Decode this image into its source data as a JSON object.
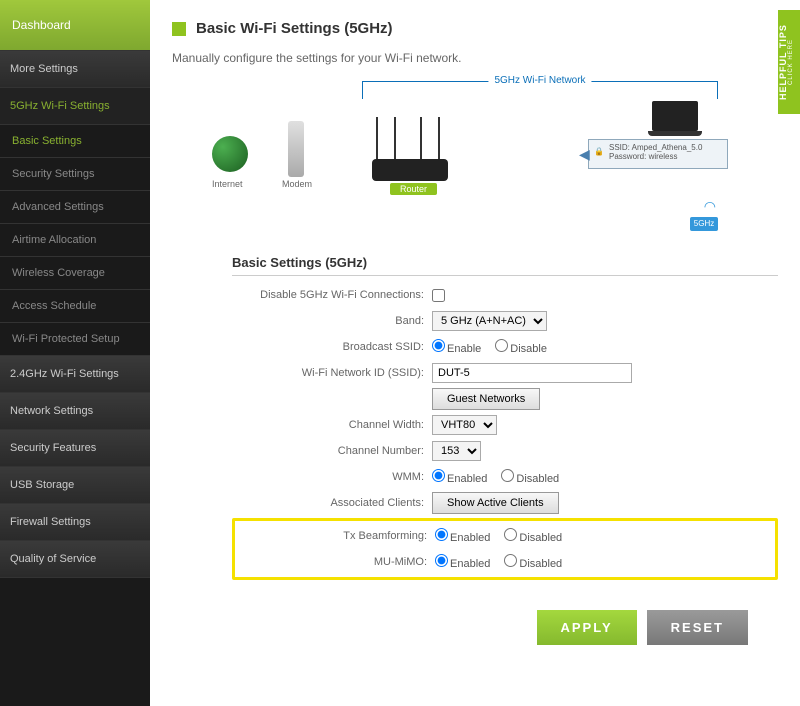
{
  "sidebar": {
    "dashboard": "Dashboard",
    "more": "More Settings",
    "section5g": "5GHz Wi-Fi Settings",
    "subs": [
      "Basic Settings",
      "Security Settings",
      "Advanced Settings",
      "Airtime Allocation",
      "Wireless Coverage",
      "Access Schedule",
      "Wi-Fi Protected Setup"
    ],
    "rest": [
      "2.4GHz Wi-Fi Settings",
      "Network Settings",
      "Security Features",
      "USB Storage",
      "Firewall Settings",
      "Quality of Service"
    ]
  },
  "page": {
    "title": "Basic Wi-Fi Settings (5GHz)",
    "subtitle": "Manually configure the settings for your Wi-Fi network.",
    "section": "Basic Settings (5GHz)"
  },
  "diagram": {
    "top": "5GHz Wi-Fi Network",
    "internet": "Internet",
    "modem": "Modem",
    "router": "Router",
    "ssid_l": "SSID: Amped_Athena_5.0",
    "pwd_l": "Password: wireless",
    "badge": "5GHz"
  },
  "form": {
    "disable_l": "Disable 5GHz Wi-Fi Connections:",
    "band_l": "Band:",
    "band_v": "5 GHz (A+N+AC)",
    "bcast_l": "Broadcast SSID:",
    "enable": "Enable",
    "disable": "Disable",
    "ssid_l": "Wi-Fi Network ID (SSID):",
    "ssid_v": "DUT-5",
    "guest_btn": "Guest Networks",
    "cw_l": "Channel Width:",
    "cw_v": "VHT80",
    "cn_l": "Channel Number:",
    "cn_v": "153",
    "wmm_l": "WMM:",
    "enabled": "Enabled",
    "disabled": "Disabled",
    "assoc_l": "Associated Clients:",
    "assoc_btn": "Show Active Clients",
    "txbf_l": "Tx Beamforming:",
    "mumimo_l": "MU-MiMO:"
  },
  "actions": {
    "apply": "APPLY",
    "reset": "RESET"
  },
  "helpful": {
    "t": "HELPFUL TIPS",
    "s": "CLICK HERE"
  }
}
